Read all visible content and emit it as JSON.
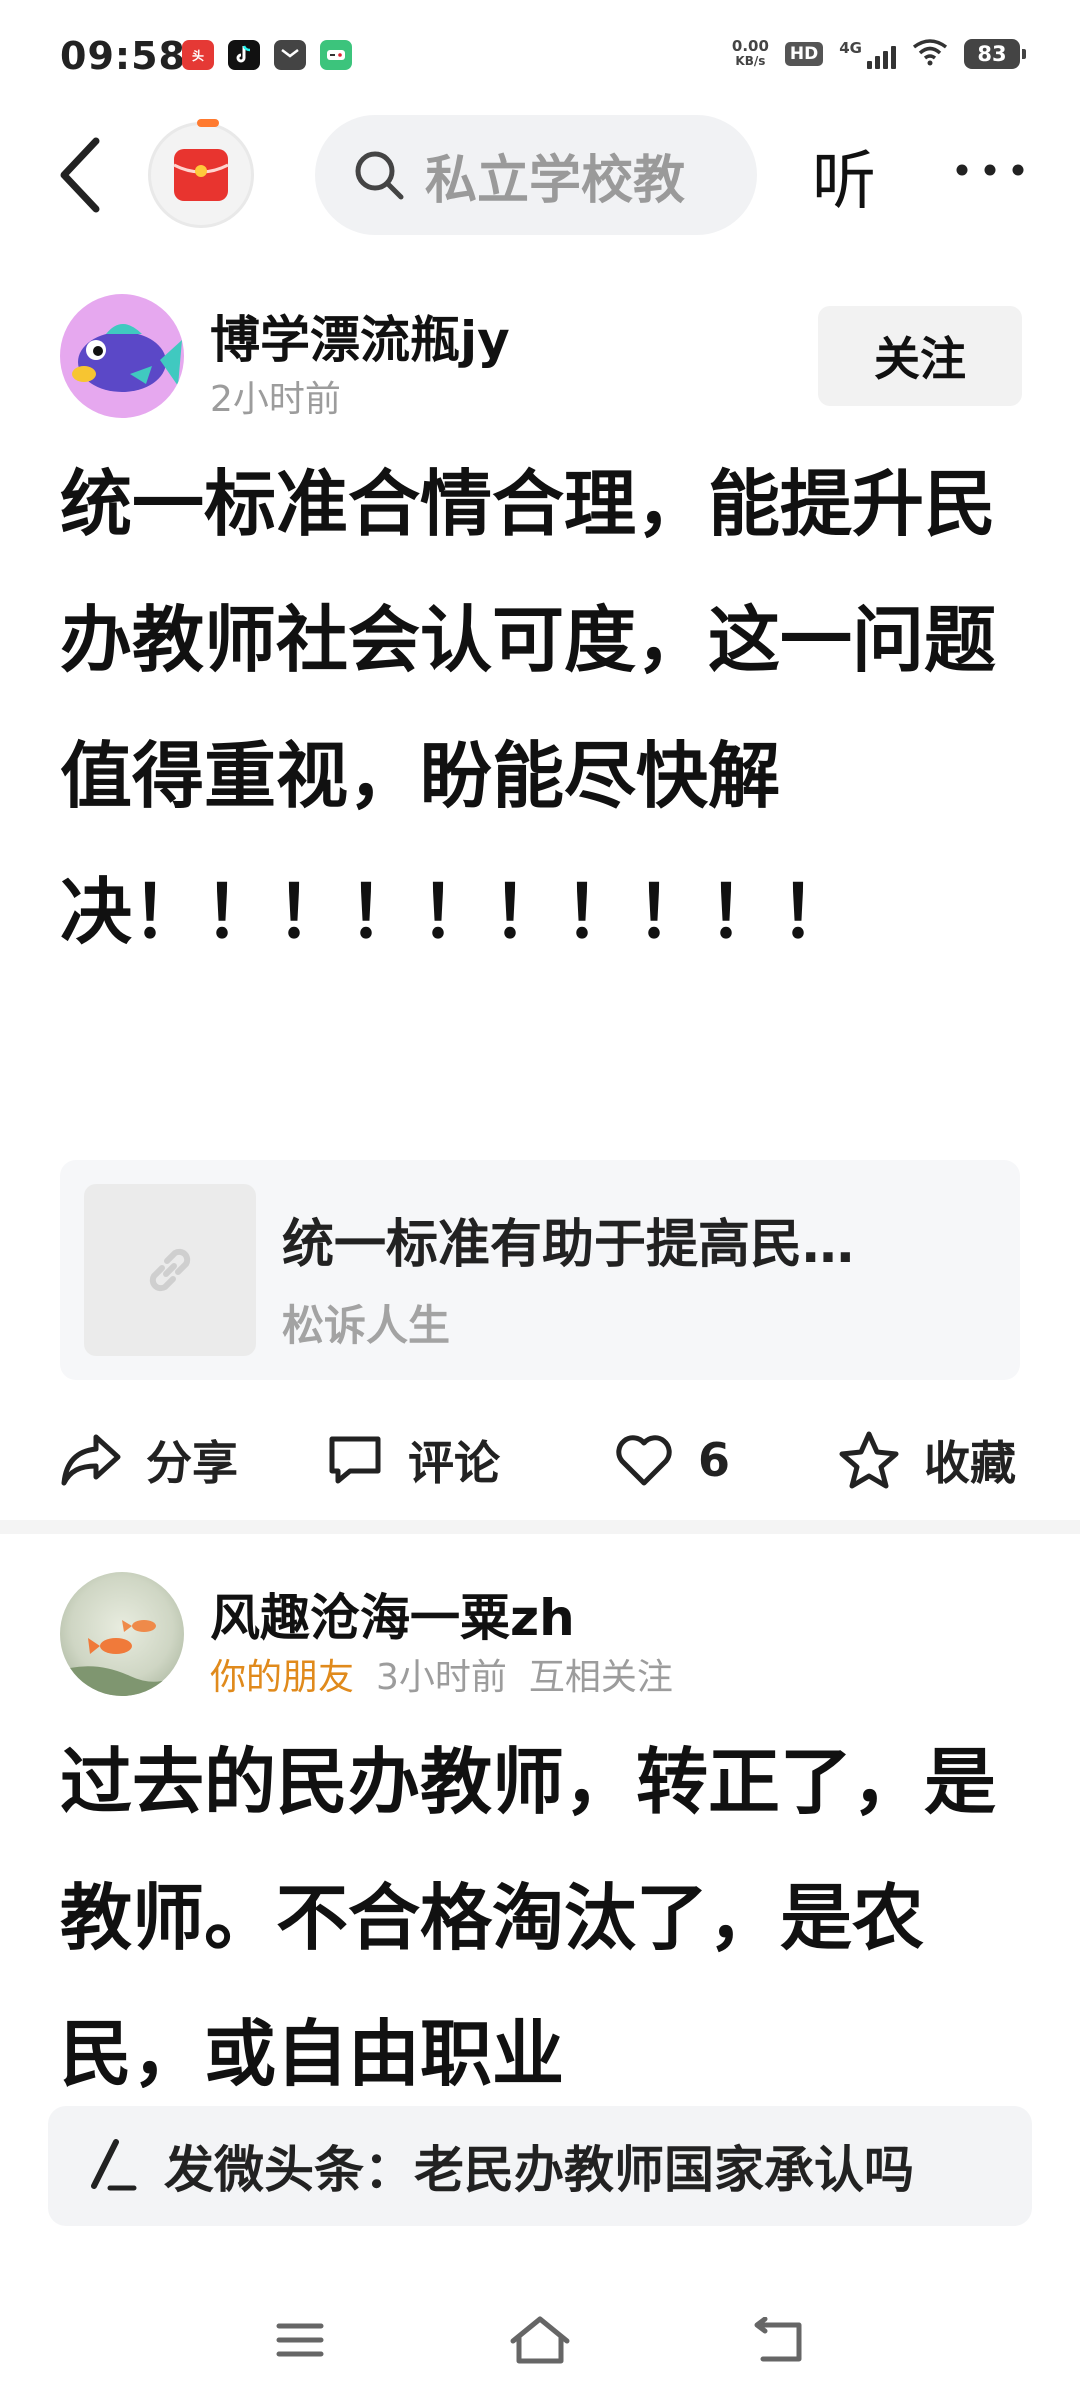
{
  "status_bar": {
    "time": "09:58",
    "net_speed_value": "0.00",
    "net_speed_unit": "KB/s",
    "hd": "HD",
    "network": "4G",
    "battery": "83",
    "app_icons": [
      "toutiao-icon",
      "tiktok-icon",
      "mail-icon",
      "game-icon"
    ]
  },
  "top_nav": {
    "search_text": "私立学校教",
    "listen_label": "听"
  },
  "posts": [
    {
      "author": "博学漂流瓶jy",
      "time": "2小时前",
      "follow_label": "关注",
      "body": "统一标准合情合理，能提升民办教师社会认可度，这一问题值得重视，盼能尽快解决！！！！！！！！！！",
      "link": {
        "title": "统一标准有助于提高民…",
        "source": "松诉人生"
      },
      "actions": {
        "share": "分享",
        "comment": "评论",
        "likes": "6",
        "favorite": "收藏"
      }
    },
    {
      "author": "风趣沧海一粟zh",
      "friend_tag": "你的朋友",
      "time": "3小时前",
      "relation": "互相关注",
      "body": "过去的民办教师，转正了，是教师。不合格淘汰了，是农民，或自由职业"
    }
  ],
  "composer": {
    "text": "发微头条：老民办教师国家承认吗"
  },
  "colors": {
    "friend_tag": "#e08a1c",
    "logo_red": "#e8342f",
    "accent_orange": "#ff7a2f"
  }
}
